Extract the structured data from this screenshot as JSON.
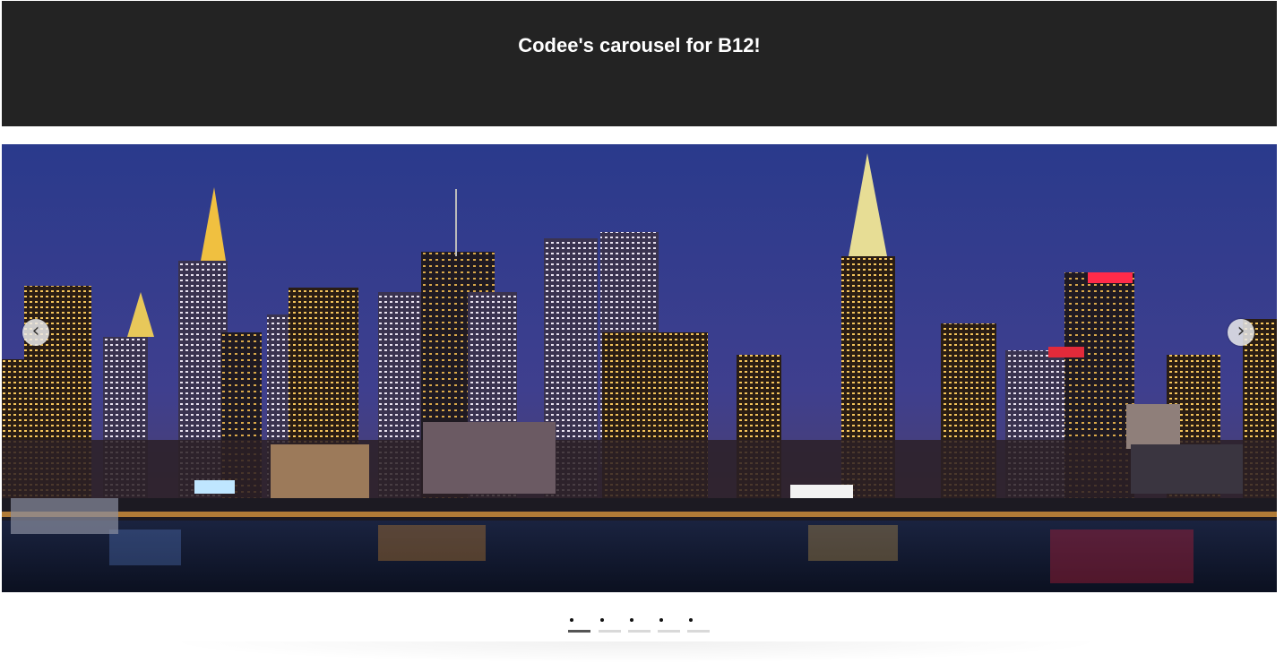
{
  "header": {
    "title": "Codee's carousel for B12!"
  },
  "carousel": {
    "current_slide": 1,
    "total_slides": 5,
    "slide_image": "night-city-skyline-waterfront",
    "prev_icon": "chevron-left-icon",
    "next_icon": "chevron-right-icon",
    "prev_glyph": "‹",
    "next_glyph": "›"
  },
  "colors": {
    "header_bg": "#232323",
    "header_text": "#ffffff",
    "dot_active": "#555555",
    "dot_inactive": "#d9d9d9"
  }
}
